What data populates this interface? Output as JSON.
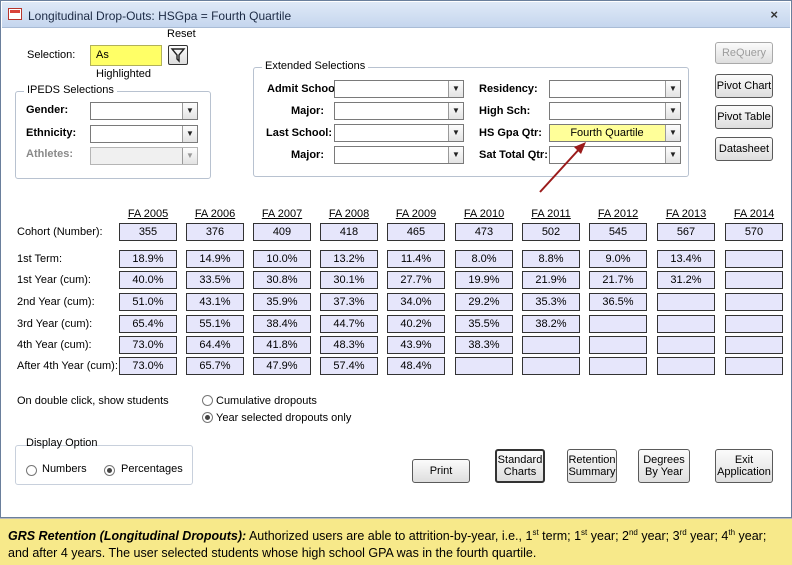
{
  "window": {
    "title": "Longitudinal Drop-Outs: HSGpa = Fourth Quartile",
    "close_label": "×"
  },
  "selection": {
    "label": "Selection:",
    "value": "As Highlighted",
    "reset_label": "Reset"
  },
  "ipeds": {
    "title": "IPEDS Selections",
    "gender_label": "Gender:",
    "gender_value": "",
    "ethnicity_label": "Ethnicity:",
    "ethnicity_value": "",
    "athletes_label": "Athletes:",
    "athletes_value": ""
  },
  "extended": {
    "title": "Extended Selections",
    "admit_school_label": "Admit School:",
    "admit_school_value": "",
    "major1_label": "Major:",
    "major1_value": "",
    "last_school_label": "Last School:",
    "last_school_value": "",
    "major2_label": "Major:",
    "major2_value": "",
    "residency_label": "Residency:",
    "residency_value": "",
    "hs_label": "High Sch:",
    "hs_value": "",
    "hsgpa_label": "HS Gpa Qtr:",
    "hsgpa_value": "Fourth Quartile",
    "sat_label": "Sat Total Qtr:",
    "sat_value": ""
  },
  "side_buttons": {
    "requery": "ReQuery",
    "pivot_chart": "Pivot Chart",
    "pivot_table": "Pivot Table",
    "datasheet": "Datasheet"
  },
  "table": {
    "years": [
      "FA 2005",
      "FA 2006",
      "FA 2007",
      "FA 2008",
      "FA 2009",
      "FA 2010",
      "FA 2011",
      "FA 2012",
      "FA 2013",
      "FA 2014"
    ],
    "rows": [
      {
        "label": "Cohort (Number):",
        "values": [
          "355",
          "376",
          "409",
          "418",
          "465",
          "473",
          "502",
          "545",
          "567",
          "570"
        ]
      },
      {
        "label": "1st Term:",
        "values": [
          "18.9%",
          "14.9%",
          "10.0%",
          "13.2%",
          "11.4%",
          "8.0%",
          "8.8%",
          "9.0%",
          "13.4%",
          ""
        ]
      },
      {
        "label": "1st Year (cum):",
        "values": [
          "40.0%",
          "33.5%",
          "30.8%",
          "30.1%",
          "27.7%",
          "19.9%",
          "21.9%",
          "21.7%",
          "31.2%",
          ""
        ]
      },
      {
        "label": "2nd Year (cum):",
        "values": [
          "51.0%",
          "43.1%",
          "35.9%",
          "37.3%",
          "34.0%",
          "29.2%",
          "35.3%",
          "36.5%",
          "",
          ""
        ]
      },
      {
        "label": "3rd Year (cum):",
        "values": [
          "65.4%",
          "55.1%",
          "38.4%",
          "44.7%",
          "40.2%",
          "35.5%",
          "38.2%",
          "",
          "",
          ""
        ]
      },
      {
        "label": "4th Year (cum):",
        "values": [
          "73.0%",
          "64.4%",
          "41.8%",
          "48.3%",
          "43.9%",
          "38.3%",
          "",
          "",
          "",
          ""
        ]
      },
      {
        "label": "After 4th Year (cum):",
        "values": [
          "73.0%",
          "65.7%",
          "47.9%",
          "57.4%",
          "48.4%",
          "",
          "",
          "",
          "",
          ""
        ]
      }
    ]
  },
  "dblclick": {
    "label": "On double click, show students",
    "opt_cumulative": "Cumulative dropouts",
    "opt_year": "Year selected dropouts only",
    "selected": "year"
  },
  "display": {
    "title": "Display Option",
    "opt_numbers": "Numbers",
    "opt_percentages": "Percentages",
    "selected": "percentages"
  },
  "bottom_buttons": {
    "print": "Print",
    "standard_charts": "Standard Charts",
    "retention_summary": "Retention Summary",
    "degrees_by_year": "Degrees By Year",
    "exit_application": "Exit Application"
  },
  "caption": {
    "lead": "GRS Retention (Longitudinal Dropouts):",
    "p1": " Authorized users are able to attrition-by-year, i.e., 1",
    "s1": "st",
    "p2": " term; 1",
    "s2": "st",
    "p3": " year; 2",
    "s3": "nd",
    "p4": " year; 3",
    "s4": "rd",
    "p5": " year; 4",
    "s5": "th",
    "p6": " year; and after 4 years.  The user selected students whose high school GPA was in the fourth quartile."
  },
  "colors": {
    "highlight_yellow": "#ffff99",
    "cell_fill": "#e6e6fb",
    "caption_bg": "#f7e98a",
    "arrow": "#9b1b1b"
  }
}
